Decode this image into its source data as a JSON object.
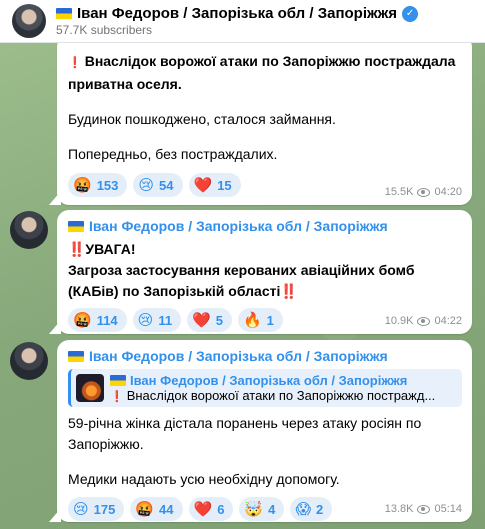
{
  "channel": {
    "title": "Іван Федоров / Запорізька обл / Запоріжжя",
    "subscribers": "57.7K subscribers"
  },
  "messages": [
    {
      "paragraphs": [
        {
          "text": "Внаслідок ворожої атаки по Запоріжжю постраждала приватна оселя.",
          "bold": true
        },
        {
          "text": "Будинок пошкоджено, сталося займання."
        },
        {
          "text": "Попередньо, без постраждалих."
        }
      ],
      "reactions": [
        {
          "emoji": "🤬",
          "count": "153"
        },
        {
          "emoji": "😢",
          "count": "54"
        },
        {
          "emoji": "❤️",
          "count": "15"
        }
      ],
      "views": "15.5K",
      "time": "04:20"
    },
    {
      "author": "Іван Федоров / Запорізька обл / Запоріжжя",
      "line1": "‼️УВАГА!",
      "line2": "Загроза застосування керованих авіаційних бомб (КАБів) по Запорізькій області‼️",
      "reactions": [
        {
          "emoji": "🤬",
          "count": "114"
        },
        {
          "emoji": "😢",
          "count": "11"
        },
        {
          "emoji": "❤️",
          "count": "5"
        },
        {
          "emoji": "🔥",
          "count": "1"
        }
      ],
      "views": "10.9K",
      "time": "04:22"
    },
    {
      "author": "Іван Федоров / Запорізька обл / Запоріжжя",
      "reply": {
        "author": "Іван Федоров / Запорізька обл / Запоріжжя",
        "text": "Внаслідок ворожої атаки по Запоріжжю постражд..."
      },
      "paragraphs": [
        {
          "text": "59-річна жінка дістала поранень через атаку росіян по Запоріжжю."
        },
        {
          "text": "Медики надають усю необхідну допомогу."
        }
      ],
      "reactions": [
        {
          "emoji": "😢",
          "count": "175"
        },
        {
          "emoji": "🤬",
          "count": "44"
        },
        {
          "emoji": "❤️",
          "count": "6"
        },
        {
          "emoji": "🤯",
          "count": "4"
        },
        {
          "emoji": "😱",
          "count": "2"
        }
      ],
      "views": "13.8K",
      "time": "05:14"
    }
  ],
  "colors": {
    "accent": "#3390ec",
    "reaction_bg": "#e4eef9"
  }
}
